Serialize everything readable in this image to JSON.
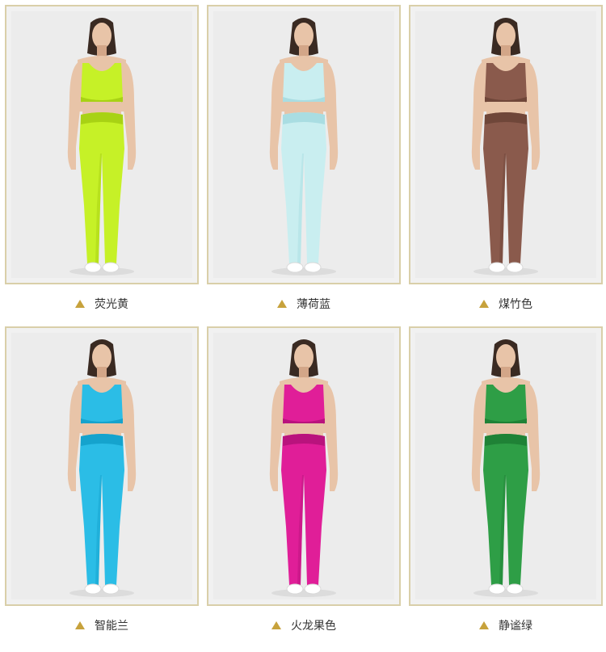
{
  "products": [
    {
      "label": "荧光黄",
      "color": "#c6f127",
      "color_dark": "#a8d214"
    },
    {
      "label": "薄荷蓝",
      "color": "#c9eef0",
      "color_dark": "#a9dde2"
    },
    {
      "label": "煤竹色",
      "color": "#8a5a4c",
      "color_dark": "#6f4639"
    },
    {
      "label": "智能兰",
      "color": "#2bbde6",
      "color_dark": "#15a3cd"
    },
    {
      "label": "火龙果色",
      "color": "#e01e98",
      "color_dark": "#b9137d"
    },
    {
      "label": "静谧绿",
      "color": "#2e9e46",
      "color_dark": "#1f8236"
    }
  ],
  "ui": {
    "bullet_icon": "triangle-icon",
    "accent": "#c7a23c",
    "frame_border": "#d9cfa9"
  }
}
